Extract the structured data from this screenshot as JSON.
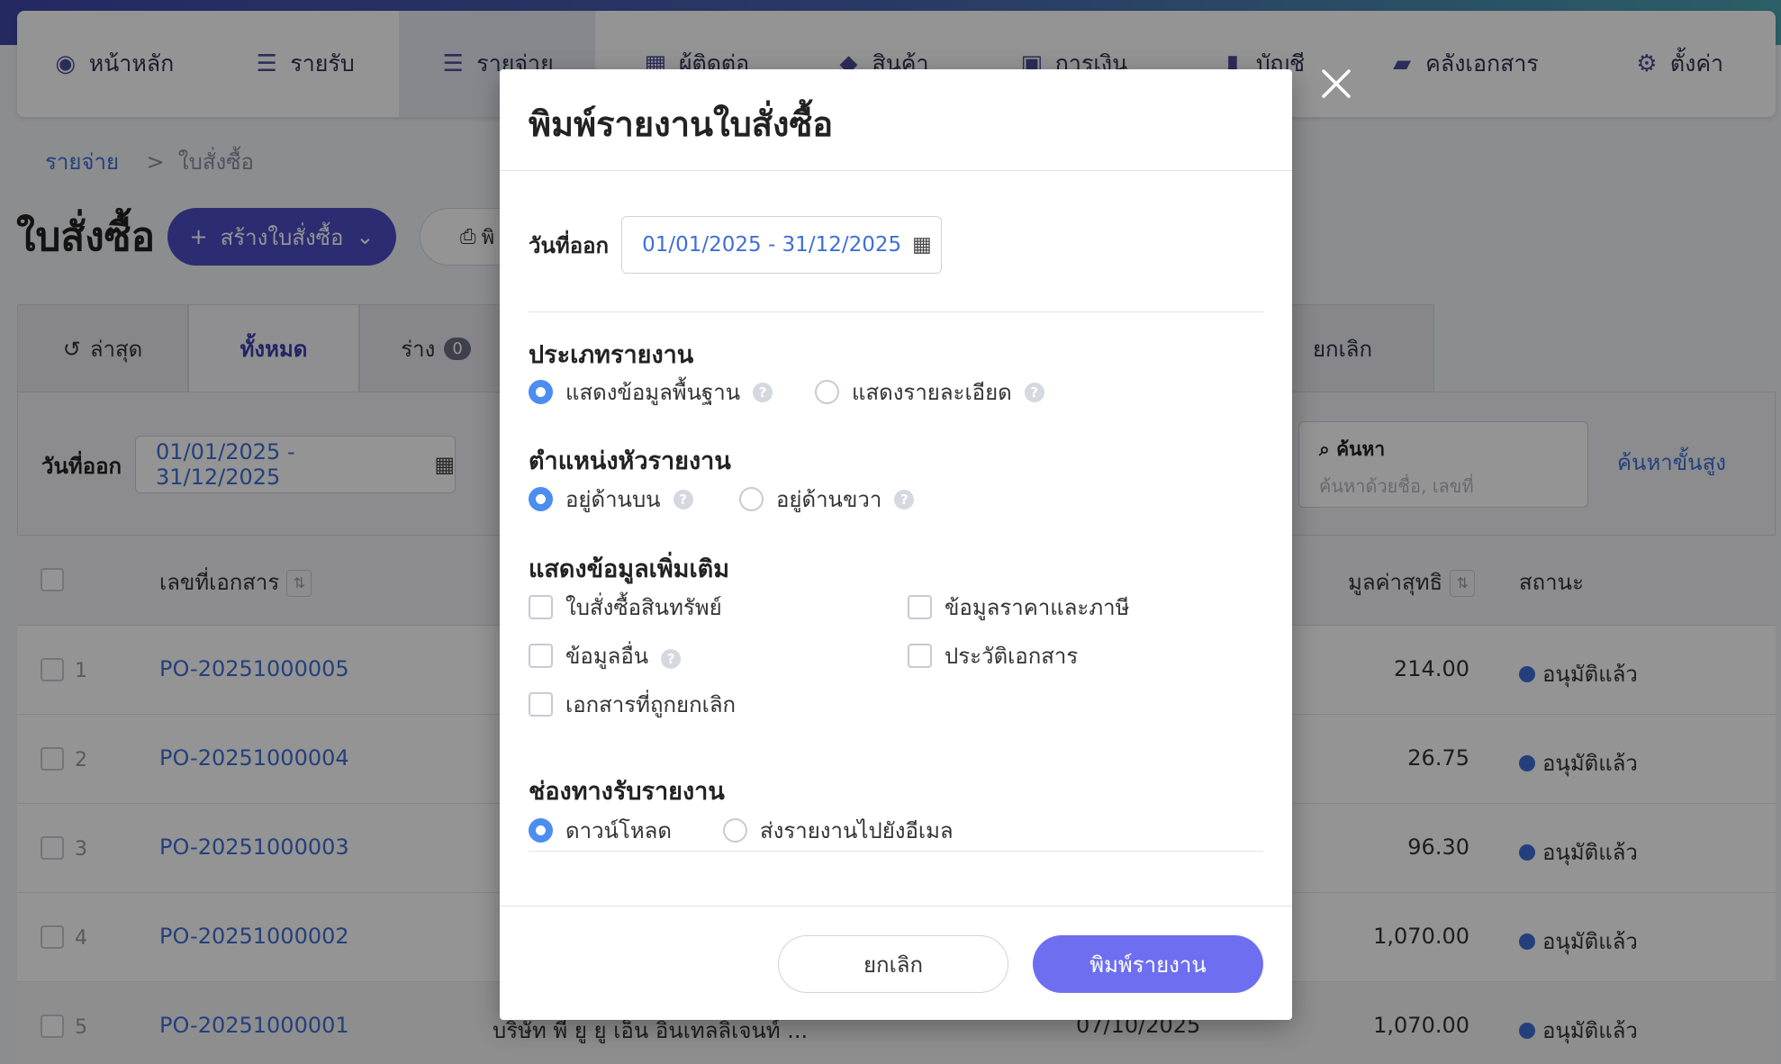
{
  "nav": [
    {
      "label": "หน้าหลัก",
      "icon": "dashboard-icon",
      "glyph": "◉"
    },
    {
      "label": "รายรับ",
      "icon": "income-list-icon",
      "glyph": "☰"
    },
    {
      "label": "รายจ่าย",
      "icon": "expense-list-icon",
      "glyph": "☰"
    },
    {
      "label": "ผู้ติดต่อ",
      "icon": "contacts-icon",
      "glyph": "▦"
    },
    {
      "label": "สินค้า",
      "icon": "box-icon",
      "glyph": "◆"
    },
    {
      "label": "การเงิน",
      "icon": "money-icon",
      "glyph": "▣"
    },
    {
      "label": "บัญชี",
      "icon": "book-icon",
      "glyph": "▮"
    },
    {
      "label": "คลังเอกสาร",
      "icon": "folder-icon",
      "glyph": "▰"
    },
    {
      "label": "ตั้งค่า",
      "icon": "gear-icon",
      "glyph": "⚙"
    }
  ],
  "breadcrumb": {
    "parent": "รายจ่าย",
    "sep": ">",
    "current": "ใบสั่งซื้อ"
  },
  "page": {
    "title": "ใบสั่งซื้อ",
    "create_label": "สร้างใบสั่งซื้อ",
    "print_label": "พิ"
  },
  "tabs": {
    "latest": "ล่าสุด",
    "all": "ทั้งหมด",
    "draft": "ร่าง",
    "draft_count": "0",
    "cancelled": "ยกเลิก"
  },
  "filter": {
    "date_label": "วันที่ออก",
    "date_value": "01/01/2025 - 31/12/2025",
    "search_title": "ค้นหา",
    "search_placeholder": "ค้นหาด้วยชื่อ, เลขที่",
    "advanced": "ค้นหาขั้นสูง"
  },
  "table": {
    "headers": {
      "doc_no": "เลขที่เอกสาร",
      "net": "มูลค่าสุทธิ",
      "status": "สถานะ"
    },
    "rows": [
      {
        "no": "1",
        "doc": "PO-20251000005",
        "amount": "214.00",
        "status": "อนุมัติแล้ว"
      },
      {
        "no": "2",
        "doc": "PO-20251000004",
        "amount": "26.75",
        "status": "อนุมัติแล้ว"
      },
      {
        "no": "3",
        "doc": "PO-20251000003",
        "amount": "96.30",
        "status": "อนุมัติแล้ว"
      },
      {
        "no": "4",
        "doc": "PO-20251000002",
        "amount": "1,070.00",
        "status": "อนุมัติแล้ว"
      },
      {
        "no": "5",
        "doc": "PO-20251000001",
        "amount": "1,070.00",
        "status": "อนุมัติแล้ว",
        "partial_text": "บริษัท พี ยู ยู เอ็น อินเทลลิเจนท์ ...",
        "partial_date": "07/10/2025"
      }
    ]
  },
  "modal": {
    "title": "พิมพ์รายงานใบสั่งซื้อ",
    "date_label": "วันที่ออก",
    "date_value": "01/01/2025 - 31/12/2025",
    "report_type": {
      "title": "ประเภทรายงาน",
      "opt_basic": "แสดงข้อมูลพื้นฐาน",
      "opt_detail": "แสดงรายละเอียด"
    },
    "header_pos": {
      "title": "ตำแหน่งหัวรายงาน",
      "opt_top": "อยู่ด้านบน",
      "opt_right": "อยู่ด้านขวา"
    },
    "extra": {
      "title": "แสดงข้อมูลเพิ่มเติม",
      "asset_po": "ใบสั่งซื้อสินทรัพย์",
      "price_tax": "ข้อมูลราคาและภาษี",
      "other": "ข้อมูลอื่น",
      "history": "ประวัติเอกสาร",
      "cancelled_docs": "เอกสารที่ถูกยกเลิก"
    },
    "channel": {
      "title": "ช่องทางรับรายงาน",
      "opt_download": "ดาวน์โหลด",
      "opt_email": "ส่งรายงานไปยังอีเมล"
    },
    "cancel_label": "ยกเลิก",
    "print_label": "พิมพ์รายงาน"
  },
  "colors": {
    "primary": "#6d6ff0",
    "link": "#3f6fd6",
    "radio_on": "#4c8df0"
  }
}
